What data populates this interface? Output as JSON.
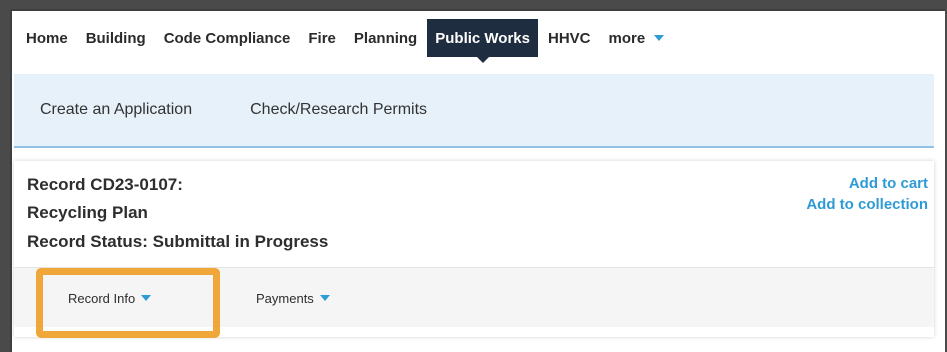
{
  "nav": {
    "items": [
      {
        "label": "Home",
        "active": false
      },
      {
        "label": "Building",
        "active": false
      },
      {
        "label": "Code Compliance",
        "active": false
      },
      {
        "label": "Fire",
        "active": false
      },
      {
        "label": "Planning",
        "active": false
      },
      {
        "label": "Public Works",
        "active": true
      },
      {
        "label": "HHVC",
        "active": false
      }
    ],
    "more_label": "more"
  },
  "subnav": {
    "items": [
      {
        "label": "Create an Application"
      },
      {
        "label": "Check/Research Permits"
      }
    ]
  },
  "record": {
    "id_line": "Record CD23-0107:",
    "type_line": "Recycling Plan",
    "status_line": "Record Status: Submittal in Progress",
    "add_to_cart": "Add to cart",
    "add_to_collection": "Add to collection",
    "tabs": [
      {
        "label": "Record Info"
      },
      {
        "label": "Payments"
      }
    ]
  },
  "colors": {
    "nav_active_bg": "#1f2d40",
    "accent_blue": "#2f9bd6",
    "subnav_bg": "#e6f1fa",
    "highlight_orange": "#f0a73a"
  }
}
